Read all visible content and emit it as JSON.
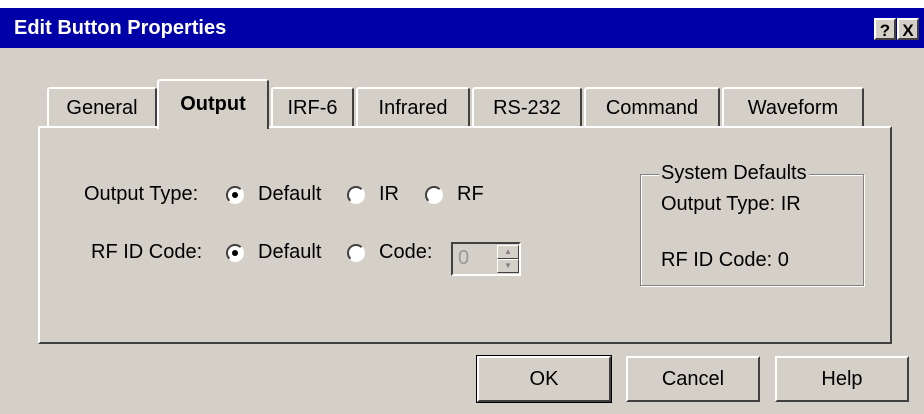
{
  "window": {
    "title": "Edit Button Properties",
    "help_btn": "?",
    "close_btn": "X"
  },
  "tabs": [
    {
      "label": "General",
      "active": false
    },
    {
      "label": "Output",
      "active": true
    },
    {
      "label": "IRF-6",
      "active": false
    },
    {
      "label": "Infrared",
      "active": false
    },
    {
      "label": "RS-232",
      "active": false
    },
    {
      "label": "Command",
      "active": false
    },
    {
      "label": "Waveform",
      "active": false
    }
  ],
  "output_type": {
    "label": "Output Type:",
    "options": [
      "Default",
      "IR",
      "RF"
    ],
    "selected": "Default"
  },
  "rf_id_code": {
    "label": "RF ID Code:",
    "options": [
      "Default",
      "Code:"
    ],
    "selected": "Default",
    "code_value": "0"
  },
  "system_defaults": {
    "title": "System Defaults",
    "output_type": "Output Type: IR",
    "rf_id_code": "RF ID Code: 0"
  },
  "buttons": {
    "ok": "OK",
    "cancel": "Cancel",
    "help": "Help"
  }
}
